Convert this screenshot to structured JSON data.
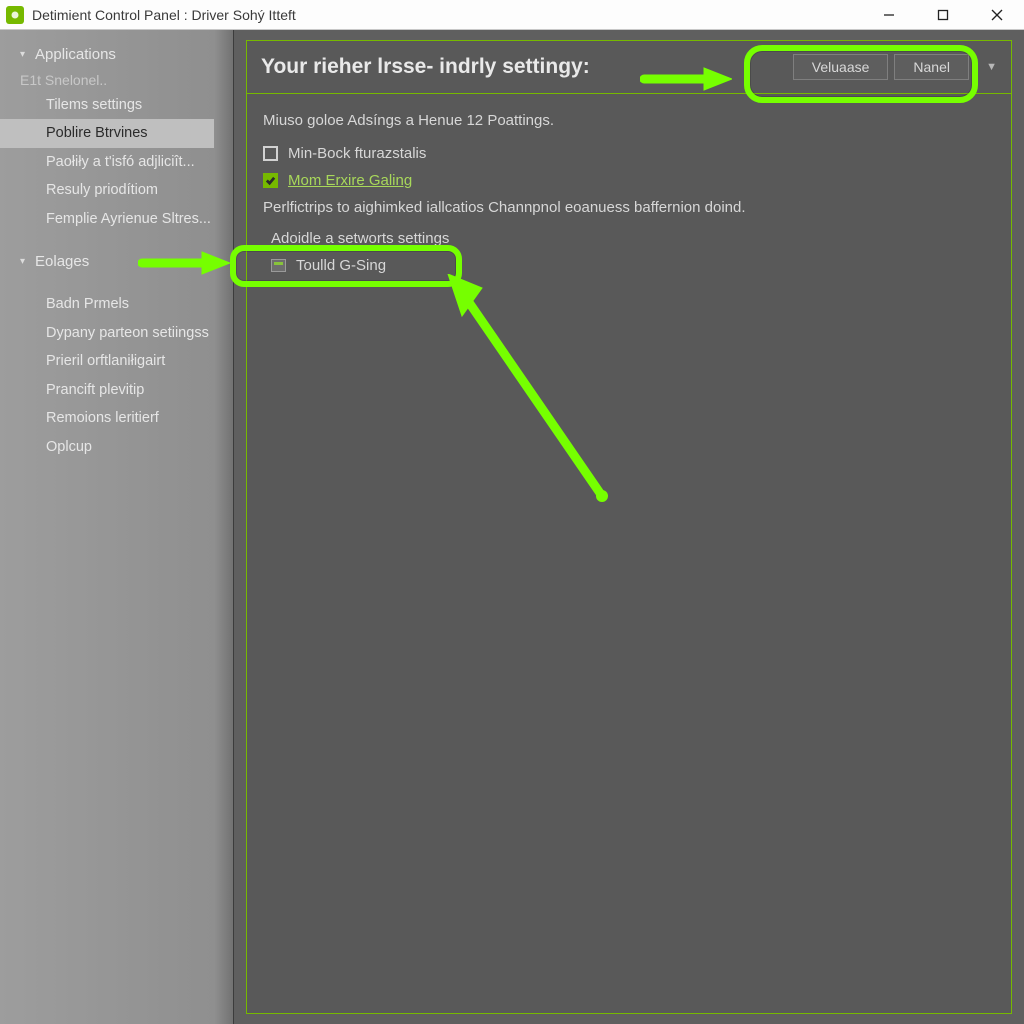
{
  "colors": {
    "accent": "#76b900",
    "highlight": "#76ff00"
  },
  "titlebar": {
    "title": "Detimient Control Panel : Driver Sohý Itteft"
  },
  "sidebar": {
    "group1": {
      "header": "Applications",
      "sub": "E1t  Snelonel..",
      "items": [
        "Tilems settings",
        "Poblire Btrvines",
        "Paołiły a t'isfó adjliciît...",
        "Resuly priodítiom",
        "Femplie Ayrienue Sltres..."
      ],
      "selectedIndex": 1
    },
    "group2": {
      "header": "Eolages",
      "items": [
        "Badn Prmels",
        "Dypany parteon setiingss",
        "Prieril orftlaniłigairt",
        "Prancift plevitip",
        "Remoions leritierf",
        "Oplcup"
      ]
    }
  },
  "main": {
    "title": "Your rieher lrsse- indrly settingy:",
    "buttons": {
      "primary": "Veluaase",
      "secondary": "Nanel"
    },
    "description": "Miuso goloe Adsíngs a Henue 12 Poattings.",
    "checkboxes": [
      {
        "label": "Min-Bock fturazstalis",
        "checked": false,
        "link": false
      },
      {
        "label": "Mom Erxire  Galing",
        "checked": true,
        "link": true
      }
    ],
    "hint": "Perlfictrips to aighimked iallcatios Channpnol eoanuess baffernion doind.",
    "sublink": "Adoidle a setworts settings",
    "miniRow": "Toulld G-Sing"
  }
}
